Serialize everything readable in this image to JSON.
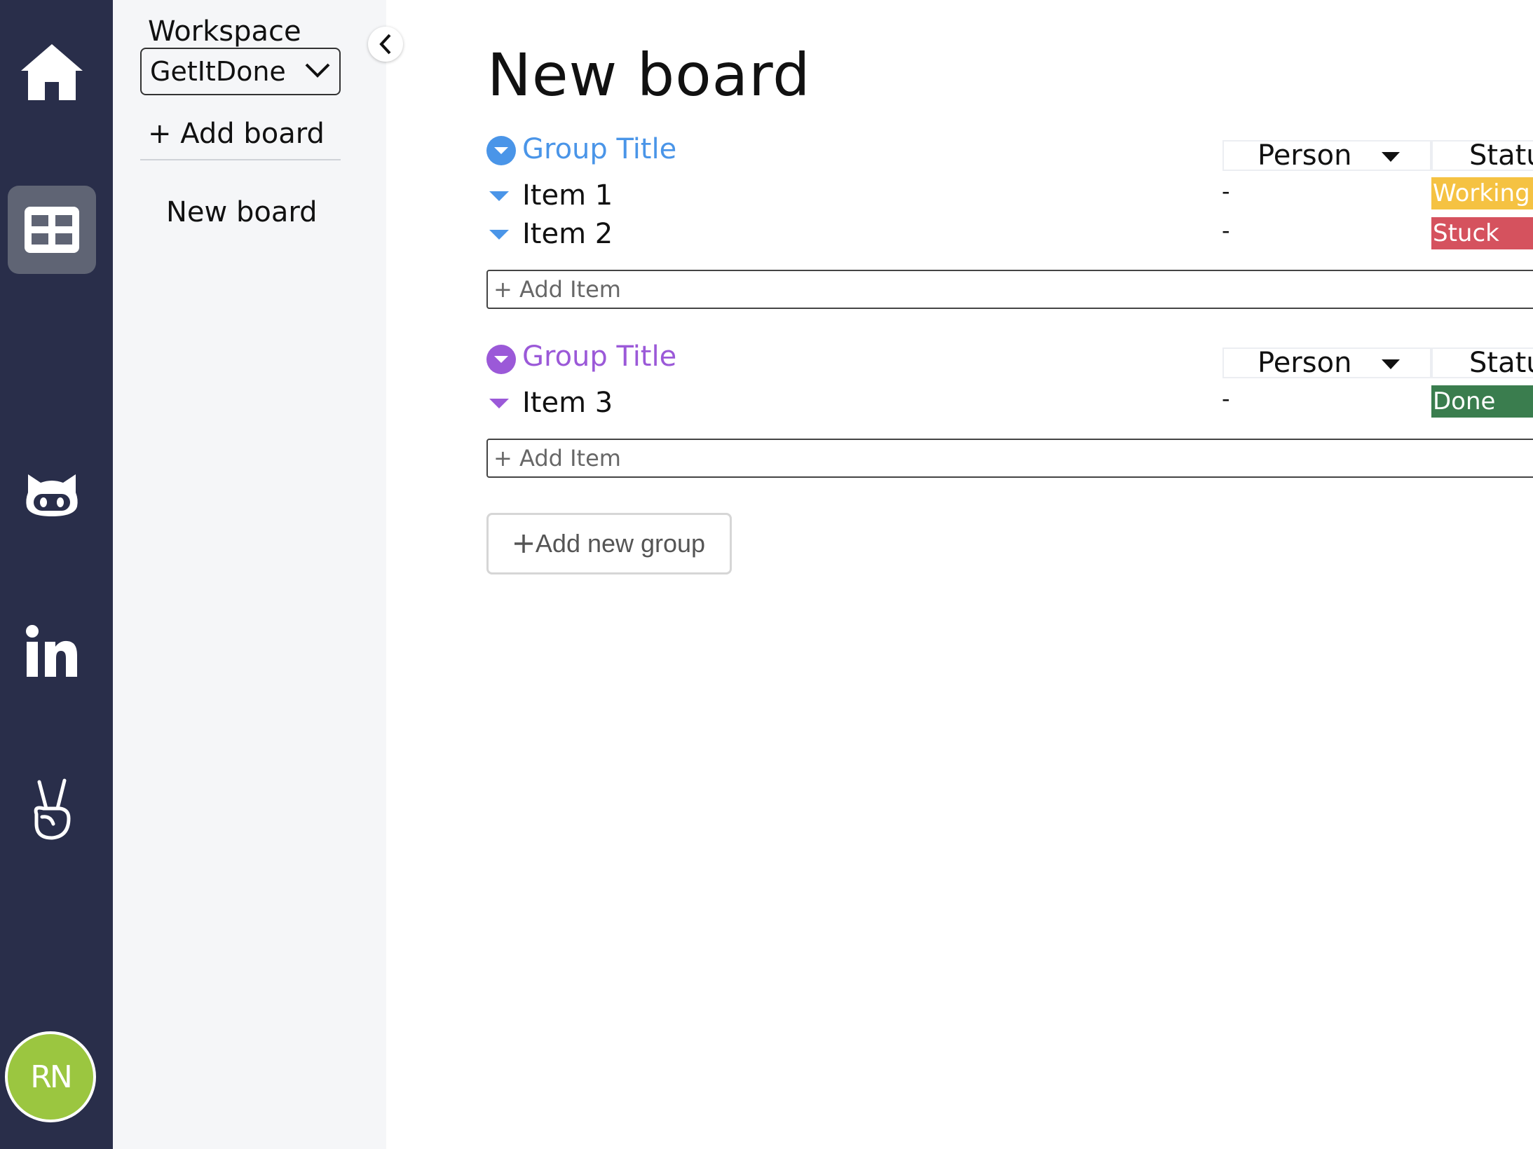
{
  "rail": {
    "items": [
      {
        "icon": "home-icon"
      },
      {
        "icon": "grid-icon",
        "active": true
      },
      {
        "icon": "github-icon"
      },
      {
        "icon": "linkedin-icon",
        "text": "in"
      },
      {
        "icon": "angellist-icon"
      }
    ],
    "avatar_initials": "RN",
    "avatar_color": "#9bc640",
    "background": "#292e4a"
  },
  "sidebar": {
    "workspace_label": "Workspace",
    "workspace_value": "GetItDone",
    "add_board_label": "+ Add board",
    "boards": [
      "New board"
    ]
  },
  "board": {
    "title": "New board",
    "columns": {
      "person": "Person",
      "status": "Statu"
    },
    "groups": [
      {
        "title": "Group Title",
        "color": "#4a95e8",
        "items": [
          {
            "name": "Item 1",
            "person": "-",
            "status": "Working",
            "status_color": "#f5c242"
          },
          {
            "name": "Item 2",
            "person": "-",
            "status": "Stuck",
            "status_color": "#d5525e"
          }
        ],
        "add_item_placeholder": "+ Add Item"
      },
      {
        "title": "Group Title",
        "color": "#9b59d8",
        "items": [
          {
            "name": "Item 3",
            "person": "-",
            "status": "Done",
            "status_color": "#3a7d4e"
          }
        ],
        "add_item_placeholder": "+ Add Item"
      }
    ],
    "add_group_label": "Add new group",
    "add_group_icon": "plus-icon"
  }
}
